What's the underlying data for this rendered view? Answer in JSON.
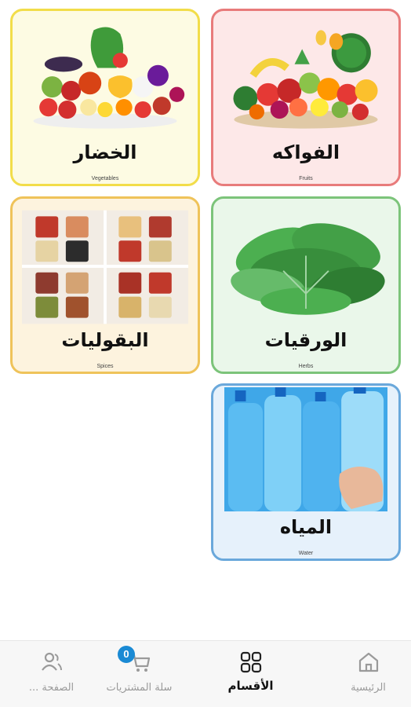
{
  "categories": [
    {
      "id": "fruits",
      "title": "الفواكه",
      "subtitle": "Fruits",
      "border": "#e87b7b",
      "bg": "#fde8e8"
    },
    {
      "id": "vegetables",
      "title": "الخضار",
      "subtitle": "Vegetables",
      "border": "#f2dd4a",
      "bg": "#fdfbe3"
    },
    {
      "id": "herbs",
      "title": "الورقيات",
      "subtitle": "Herbs",
      "border": "#7cc47a",
      "bg": "#eaf7ea"
    },
    {
      "id": "spices",
      "title": "البقوليات",
      "subtitle": "Spices",
      "border": "#efc35a",
      "bg": "#fdf3de"
    },
    {
      "id": "water",
      "title": "المياه",
      "subtitle": "Water",
      "border": "#6aa8db",
      "bg": "#e6f1fb"
    }
  ],
  "bottom_nav": {
    "home": {
      "label": "الرئيسية",
      "icon": "home-icon"
    },
    "categories": {
      "label": "الأقسام",
      "icon": "grid-icon",
      "active": true
    },
    "cart": {
      "label": "سلة المشتريات",
      "icon": "cart-icon",
      "badge": "0"
    },
    "page": {
      "label": "الصفحة ...",
      "icon": "users-icon"
    }
  },
  "colors": {
    "badge": "#1a8ad4",
    "active_text": "#111111",
    "inactive_text": "#9a9a9a"
  }
}
